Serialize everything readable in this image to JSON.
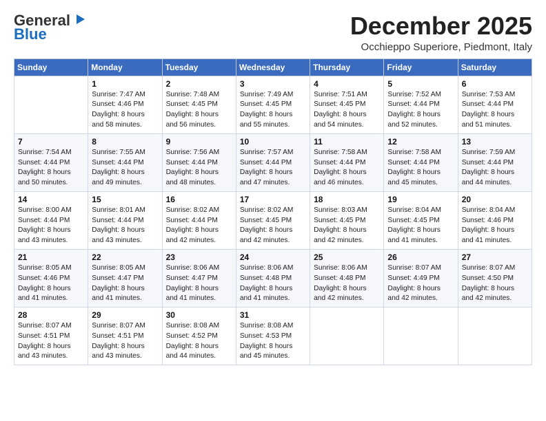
{
  "logo": {
    "general": "General",
    "blue": "Blue"
  },
  "title": "December 2025",
  "location": "Occhieppo Superiore, Piedmont, Italy",
  "days_of_week": [
    "Sunday",
    "Monday",
    "Tuesday",
    "Wednesday",
    "Thursday",
    "Friday",
    "Saturday"
  ],
  "weeks": [
    [
      {
        "day": "",
        "info": ""
      },
      {
        "day": "1",
        "info": "Sunrise: 7:47 AM\nSunset: 4:46 PM\nDaylight: 8 hours\nand 58 minutes."
      },
      {
        "day": "2",
        "info": "Sunrise: 7:48 AM\nSunset: 4:45 PM\nDaylight: 8 hours\nand 56 minutes."
      },
      {
        "day": "3",
        "info": "Sunrise: 7:49 AM\nSunset: 4:45 PM\nDaylight: 8 hours\nand 55 minutes."
      },
      {
        "day": "4",
        "info": "Sunrise: 7:51 AM\nSunset: 4:45 PM\nDaylight: 8 hours\nand 54 minutes."
      },
      {
        "day": "5",
        "info": "Sunrise: 7:52 AM\nSunset: 4:44 PM\nDaylight: 8 hours\nand 52 minutes."
      },
      {
        "day": "6",
        "info": "Sunrise: 7:53 AM\nSunset: 4:44 PM\nDaylight: 8 hours\nand 51 minutes."
      }
    ],
    [
      {
        "day": "7",
        "info": "Sunrise: 7:54 AM\nSunset: 4:44 PM\nDaylight: 8 hours\nand 50 minutes."
      },
      {
        "day": "8",
        "info": "Sunrise: 7:55 AM\nSunset: 4:44 PM\nDaylight: 8 hours\nand 49 minutes."
      },
      {
        "day": "9",
        "info": "Sunrise: 7:56 AM\nSunset: 4:44 PM\nDaylight: 8 hours\nand 48 minutes."
      },
      {
        "day": "10",
        "info": "Sunrise: 7:57 AM\nSunset: 4:44 PM\nDaylight: 8 hours\nand 47 minutes."
      },
      {
        "day": "11",
        "info": "Sunrise: 7:58 AM\nSunset: 4:44 PM\nDaylight: 8 hours\nand 46 minutes."
      },
      {
        "day": "12",
        "info": "Sunrise: 7:58 AM\nSunset: 4:44 PM\nDaylight: 8 hours\nand 45 minutes."
      },
      {
        "day": "13",
        "info": "Sunrise: 7:59 AM\nSunset: 4:44 PM\nDaylight: 8 hours\nand 44 minutes."
      }
    ],
    [
      {
        "day": "14",
        "info": "Sunrise: 8:00 AM\nSunset: 4:44 PM\nDaylight: 8 hours\nand 43 minutes."
      },
      {
        "day": "15",
        "info": "Sunrise: 8:01 AM\nSunset: 4:44 PM\nDaylight: 8 hours\nand 43 minutes."
      },
      {
        "day": "16",
        "info": "Sunrise: 8:02 AM\nSunset: 4:44 PM\nDaylight: 8 hours\nand 42 minutes."
      },
      {
        "day": "17",
        "info": "Sunrise: 8:02 AM\nSunset: 4:45 PM\nDaylight: 8 hours\nand 42 minutes."
      },
      {
        "day": "18",
        "info": "Sunrise: 8:03 AM\nSunset: 4:45 PM\nDaylight: 8 hours\nand 42 minutes."
      },
      {
        "day": "19",
        "info": "Sunrise: 8:04 AM\nSunset: 4:45 PM\nDaylight: 8 hours\nand 41 minutes."
      },
      {
        "day": "20",
        "info": "Sunrise: 8:04 AM\nSunset: 4:46 PM\nDaylight: 8 hours\nand 41 minutes."
      }
    ],
    [
      {
        "day": "21",
        "info": "Sunrise: 8:05 AM\nSunset: 4:46 PM\nDaylight: 8 hours\nand 41 minutes."
      },
      {
        "day": "22",
        "info": "Sunrise: 8:05 AM\nSunset: 4:47 PM\nDaylight: 8 hours\nand 41 minutes."
      },
      {
        "day": "23",
        "info": "Sunrise: 8:06 AM\nSunset: 4:47 PM\nDaylight: 8 hours\nand 41 minutes."
      },
      {
        "day": "24",
        "info": "Sunrise: 8:06 AM\nSunset: 4:48 PM\nDaylight: 8 hours\nand 41 minutes."
      },
      {
        "day": "25",
        "info": "Sunrise: 8:06 AM\nSunset: 4:48 PM\nDaylight: 8 hours\nand 42 minutes."
      },
      {
        "day": "26",
        "info": "Sunrise: 8:07 AM\nSunset: 4:49 PM\nDaylight: 8 hours\nand 42 minutes."
      },
      {
        "day": "27",
        "info": "Sunrise: 8:07 AM\nSunset: 4:50 PM\nDaylight: 8 hours\nand 42 minutes."
      }
    ],
    [
      {
        "day": "28",
        "info": "Sunrise: 8:07 AM\nSunset: 4:51 PM\nDaylight: 8 hours\nand 43 minutes."
      },
      {
        "day": "29",
        "info": "Sunrise: 8:07 AM\nSunset: 4:51 PM\nDaylight: 8 hours\nand 43 minutes."
      },
      {
        "day": "30",
        "info": "Sunrise: 8:08 AM\nSunset: 4:52 PM\nDaylight: 8 hours\nand 44 minutes."
      },
      {
        "day": "31",
        "info": "Sunrise: 8:08 AM\nSunset: 4:53 PM\nDaylight: 8 hours\nand 45 minutes."
      },
      {
        "day": "",
        "info": ""
      },
      {
        "day": "",
        "info": ""
      },
      {
        "day": "",
        "info": ""
      }
    ]
  ]
}
